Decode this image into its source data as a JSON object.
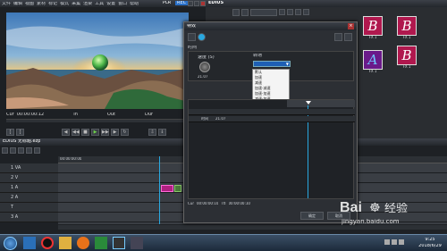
{
  "main_window": {
    "menu": [
      "文件",
      "编辑",
      "视图",
      "素材",
      "标记",
      "模式",
      "采集",
      "渲染",
      "工具",
      "设置",
      "窗口",
      "帮助"
    ],
    "plr_label": "PLR",
    "rec_label": "REC",
    "cur_label": "Cur",
    "cur_timecode": "00:00:00:12",
    "in_label": "In",
    "out_label": "Out",
    "dur_label": "Dur"
  },
  "bin_window": {
    "title": "EDIUS",
    "clips": [
      {
        "name": "FX  1",
        "glyph": "B"
      },
      {
        "name": "FX  1",
        "glyph": "B"
      },
      {
        "name": "FX  1",
        "glyph": "B"
      },
      {
        "name": "FX  1",
        "glyph": "A"
      },
      {
        "name": "FX  1",
        "glyph": "B"
      }
    ]
  },
  "dialog": {
    "title": "特效",
    "tab_label": "时间",
    "speed_label": "速度 (S)",
    "speed_value": "21.07",
    "easing_label": "转场",
    "dropdown_options": [
      "默认",
      "加速",
      "减速",
      "加速-减速",
      "加速-加速",
      "减速-加速",
      "减速-减速",
      "随机"
    ],
    "selected_index": 6,
    "track_label": "时间",
    "track_value": "21.07",
    "cur_label": "Cur",
    "cur_time": "00:00:00:10",
    "ttl_label": "Ttl",
    "ttl_time": "00:00:00:10",
    "ok_label": "确定",
    "cancel_label": "取消"
  },
  "timeline": {
    "title": "EDIUS  无标题.ezp",
    "tracks": [
      "1 VA",
      "2 V",
      "1 A",
      "2 A",
      "T",
      "3 A"
    ],
    "ruler_label": "00:00:00:00"
  },
  "taskbar": {
    "clock_time": "9:25",
    "clock_date": "2018/6/29"
  },
  "watermark": {
    "brand": "Bai",
    "brand2": "经验",
    "url": "jingyan.baidu.com"
  },
  "colors": {
    "accent": "#29a8e0",
    "pink": "#ff6bd8",
    "clip_bg": "#b0184e",
    "highlight": "#3d7ac8"
  }
}
